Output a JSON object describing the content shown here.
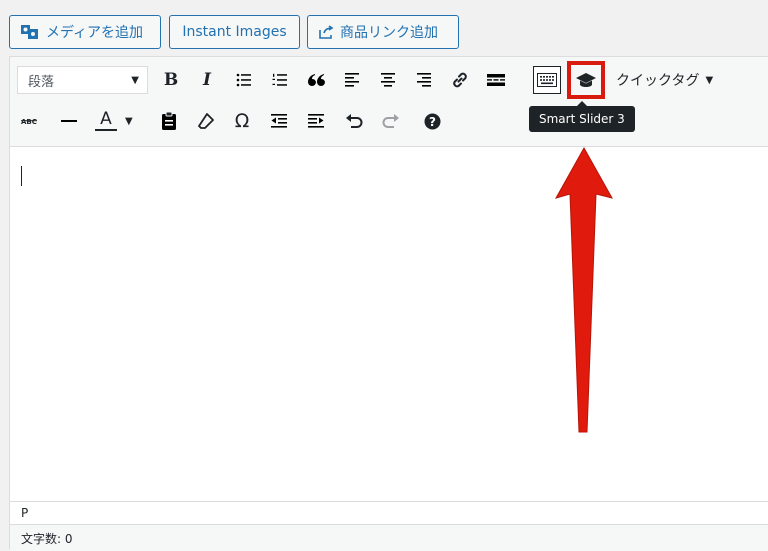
{
  "top_buttons": {
    "media": "メディアを追加",
    "instant": "Instant Images",
    "product_link": "商品リンク追加"
  },
  "toolbar": {
    "format_select": "段落",
    "bold": "B",
    "italic": "I",
    "blockquote": "66",
    "text_color": "A",
    "special_char": "Ω",
    "quicktag": "クイックタグ",
    "tooltip": "Smart Slider 3"
  },
  "editor": {
    "path": "P",
    "word_count": "文字数: 0"
  },
  "colors": {
    "accent": "#2271b1",
    "highlight": "#d81b0e",
    "arrow": "#e01a0d"
  },
  "icons": [
    "media-icon",
    "share-icon",
    "bulleted-list-icon",
    "numbered-list-icon",
    "blockquote-icon",
    "align-left-icon",
    "align-center-icon",
    "align-right-icon",
    "link-icon",
    "read-more-icon",
    "toolbar-toggle-icon",
    "graduation-cap-icon",
    "strikethrough-icon",
    "horizontal-line-icon",
    "paste-as-text-icon",
    "eraser-icon",
    "outdent-icon",
    "indent-icon",
    "undo-icon",
    "redo-icon",
    "help-icon"
  ]
}
